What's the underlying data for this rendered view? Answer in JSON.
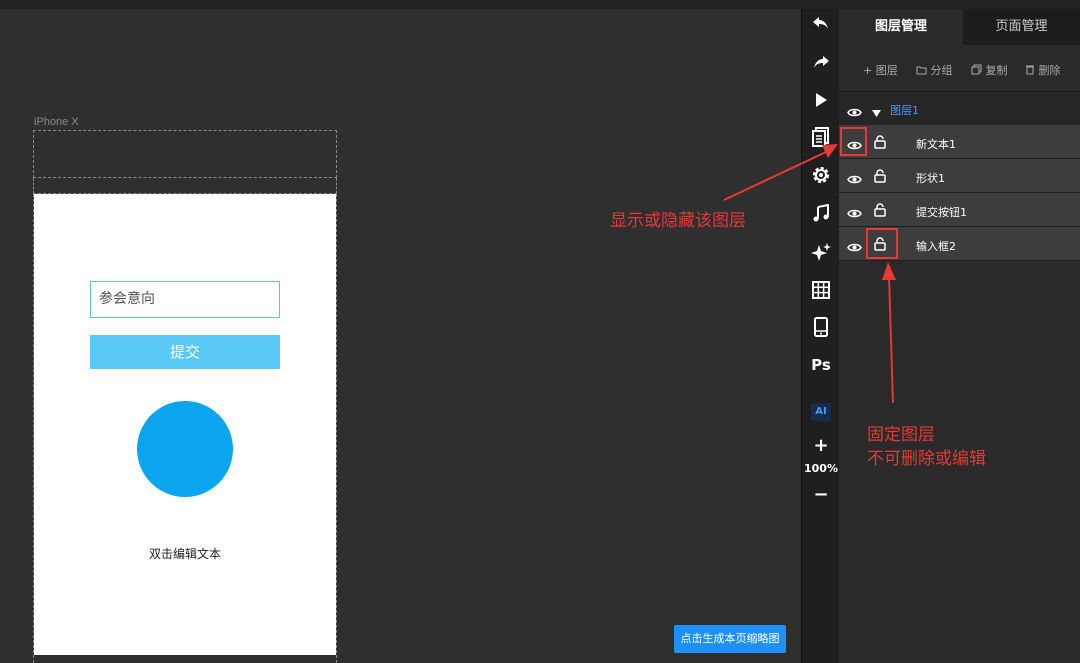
{
  "device": {
    "label": "iPhone X"
  },
  "canvas": {
    "input_placeholder": "参会意向",
    "submit_label": "提交",
    "text_label": "双击编辑文本",
    "thumbnail_button": "点击生成本页缩略图",
    "circle_color": "#0aa5ee"
  },
  "toolbar": {
    "tools": [
      "undo-icon",
      "redo-icon",
      "play-icon",
      "pages-icon",
      "settings-icon",
      "music-icon",
      "sparkle-icon",
      "grid-icon",
      "phone-icon",
      "photoshop-icon",
      "ai-icon",
      "zoom-in-icon",
      "zoom-out-icon"
    ],
    "ps_label": "Ps",
    "ai_label": "AI",
    "zoom_in": "+",
    "zoom_level": "100%",
    "zoom_out": "−"
  },
  "panel": {
    "tab_layers": "图层管理",
    "tab_pages": "页面管理",
    "actions": {
      "add_layer": "+ 图层",
      "group": "分组",
      "copy": "复制",
      "delete": "删除"
    },
    "group_name": "图层1",
    "layers": [
      {
        "name": "新文本1"
      },
      {
        "name": "形状1"
      },
      {
        "name": "提交按钮1"
      },
      {
        "name": "输入框2"
      }
    ]
  },
  "annotations": {
    "show_hide": "显示或隐藏该图层",
    "fixed_line1": "固定图层",
    "fixed_line2": "不可删除或编辑"
  },
  "colors": {
    "accent": "#1e90ff",
    "annotation": "#e53935",
    "group_name": "#3f9eff"
  }
}
